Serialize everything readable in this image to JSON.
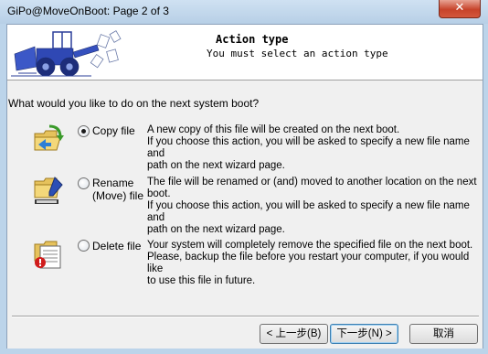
{
  "window": {
    "title": "GiPo@MoveOnBoot: Page 2 of 3",
    "close_glyph": "✕"
  },
  "header": {
    "title": "Action type",
    "subtitle": "You must select an action type",
    "art_icon": "bulldozer-illustration"
  },
  "question": "What would you like to do on the next system boot?",
  "options": [
    {
      "label": "Copy file",
      "checked": true,
      "icon": "copy-folder-icon",
      "description": "A new copy of this file will be created on the next boot.\nIf you choose this action, you will be asked to specify a new file name and\npath on the next wizard page."
    },
    {
      "label_line1": "Rename",
      "label_line2": "(Move) file",
      "checked": false,
      "icon": "rename-folder-icon",
      "description": "The file will be renamed or (and) moved to another location on the next boot.\nIf you choose this action, you will be asked to specify a new file name and\npath on the next wizard page."
    },
    {
      "label": "Delete file",
      "checked": false,
      "icon": "delete-file-icon",
      "description": "Your system will completely remove the specified file on the next boot.\nPlease, backup the file before you restart your computer, if you would like\nto use this file in future."
    }
  ],
  "buttons": {
    "back": "< 上一步(B)",
    "next": "下一步(N) >",
    "cancel": "取消"
  }
}
